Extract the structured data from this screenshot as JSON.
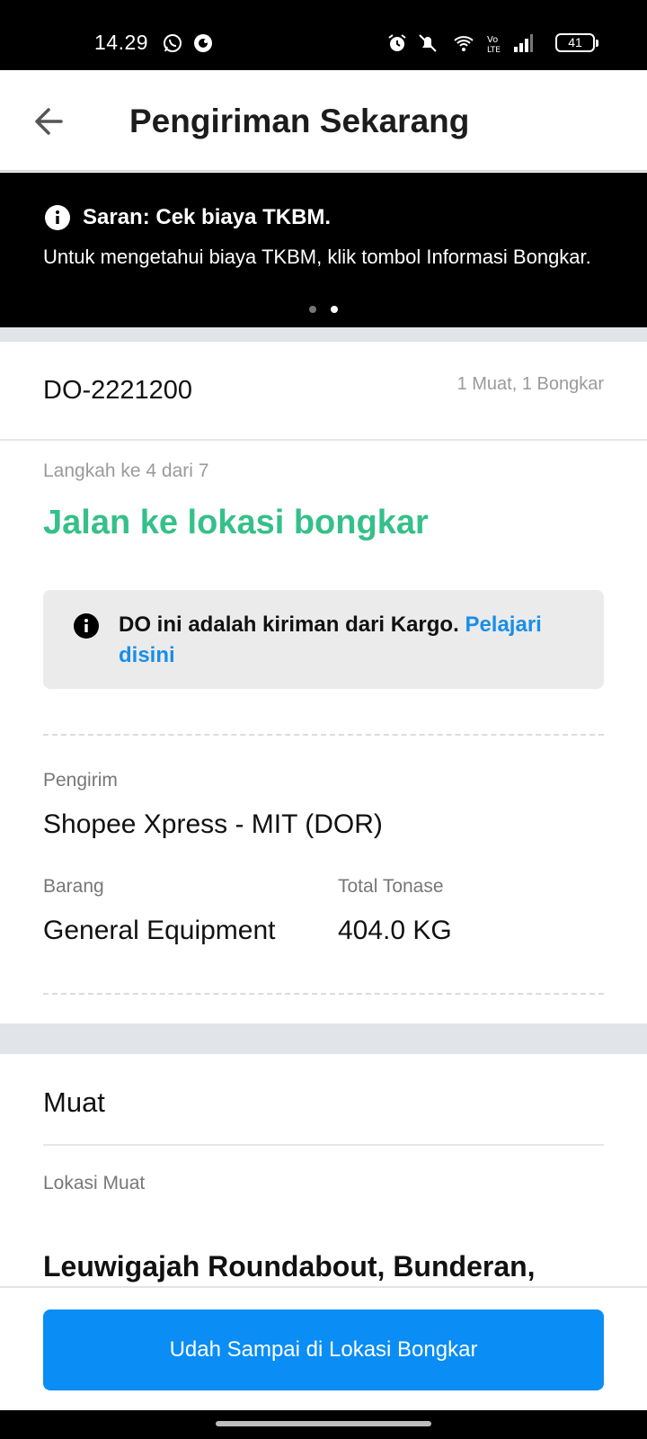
{
  "status_bar": {
    "time": "14.29",
    "battery": "41",
    "icons": [
      "whatsapp-icon",
      "notification-app-icon",
      "alarm-icon",
      "vibrate-off-icon",
      "wifi-icon",
      "volte-icon",
      "signal-icon",
      "battery-icon"
    ]
  },
  "header": {
    "title": "Pengiriman Sekarang",
    "back_icon": "arrow-left-icon"
  },
  "banner": {
    "title": "Saran: Cek biaya TKBM.",
    "text": "Untuk mengetahui biaya TKBM, klik tombol Informasi Bongkar.",
    "dots_total": 2,
    "active_dot": 2
  },
  "order": {
    "id": "DO-2221200",
    "summary": "1 Muat, 1 Bongkar",
    "step_label": "Langkah ke 4 dari 7",
    "step_title": "Jalan ke lokasi bongkar",
    "info_text": "DO ini adalah kiriman dari Kargo.",
    "info_link": "Pelajari disini",
    "shipper_label": "Pengirim",
    "shipper_value": "Shopee Xpress - MIT (DOR)",
    "goods_label": "Barang",
    "goods_value": "General Equipment",
    "tonnage_label": "Total Tonase",
    "tonnage_value": "404.0 KG"
  },
  "load": {
    "section_title": "Muat",
    "location_label": "Lokasi Muat",
    "location_value": "Leuwigajah Roundabout, Bunderan,"
  },
  "action": {
    "primary_label": "Udah Sampai di Lokasi Bongkar"
  },
  "colors": {
    "accent_green": "#35c08a",
    "primary_blue": "#0a8df4",
    "link_blue": "#1a8ee8"
  }
}
